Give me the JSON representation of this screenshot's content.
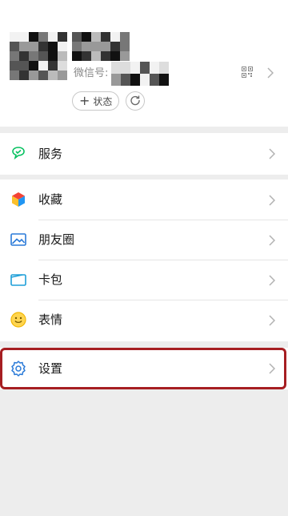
{
  "profile": {
    "wechat_id_label": "微信号:",
    "status_label": "状态",
    "plus_glyph": "+"
  },
  "menu": {
    "services": "服务",
    "favorites": "收藏",
    "moments": "朋友圈",
    "cards": "卡包",
    "stickers": "表情",
    "settings": "设置"
  },
  "colors": {
    "accent_green": "#07c160",
    "highlight_red": "#a61e22"
  },
  "icons": {
    "services": "wechat-pay-icon",
    "favorites": "cube-icon",
    "moments": "picture-icon",
    "cards": "wallet-card-icon",
    "stickers": "smiley-icon",
    "settings": "gear-icon",
    "qr": "qr-code-icon",
    "refresh": "refresh-icon"
  }
}
